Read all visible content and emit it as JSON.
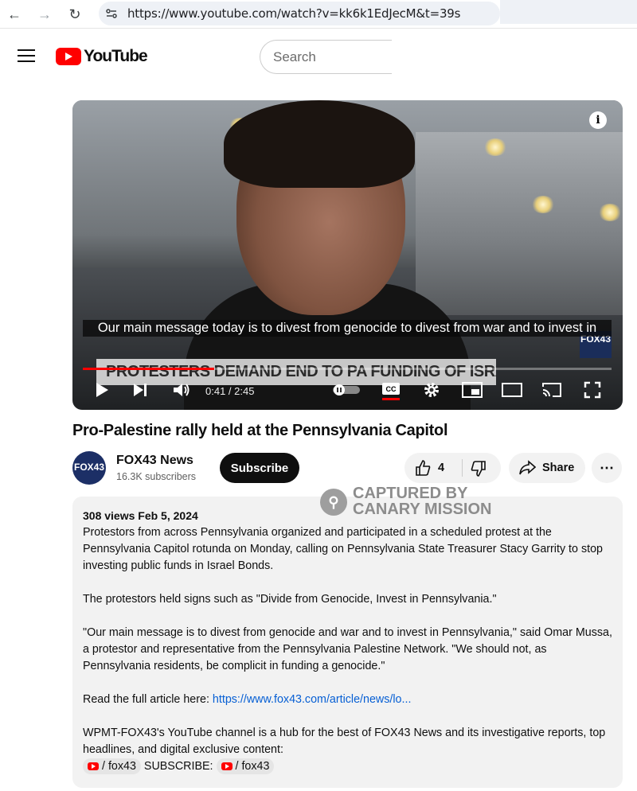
{
  "browser": {
    "url": "https://www.youtube.com/watch?v=kk6k1EdJecM&t=39s"
  },
  "header": {
    "logo_text": "YouTube",
    "search_placeholder": "Search"
  },
  "player": {
    "caption": "Our main message today is to divest from genocide to divest from war and to invest in",
    "chyron": "PROTESTERS DEMAND END TO PA FUNDING OF ISRAEL",
    "bug_text": "FOX43",
    "time": "0:41 / 2:45",
    "progress_fraction": 0.248
  },
  "video": {
    "title": "Pro-Palestine rally held at the Pennsylvania Capitol",
    "channel_name": "FOX43 News",
    "channel_avatar_text": "FOX43",
    "subscribers": "16.3K subscribers",
    "subscribe_label": "Subscribe",
    "like_count": "4",
    "share_label": "Share"
  },
  "watermark": {
    "line1": "CAPTURED BY",
    "line2": "CANARY MISSION"
  },
  "description": {
    "meta": "308 views  Feb 5, 2024",
    "p1": "Protestors from across Pennsylvania organized and participated in a scheduled protest at the Pennsylvania Capitol rotunda on Monday, calling on Pennsylvania State Treasurer Stacy Garrity to stop investing public funds in Israel Bonds.",
    "p2": "The protestors held signs such as \"Divide from Genocide, Invest in Pennsylvania.\"",
    "p3": "\"Our main message is to divest from genocide and war and to invest in Pennsylvania,\" said Omar Mussa, a protestor and representative from the Pennsylvania Palestine Network. \"We should not, as Pennsylvania residents, be complicit in funding a genocide.\"",
    "p4_prefix": "Read the full article here: ",
    "p4_link": "https://www.fox43.com/article/news/lo...",
    "p5": "WPMT-FOX43's YouTube channel is a hub for the best of FOX43 News and its investigative reports, top headlines, and digital exclusive content:",
    "chip1": "/ fox43",
    "subscribe_text": "SUBSCRIBE:",
    "chip2": "/ fox43"
  }
}
